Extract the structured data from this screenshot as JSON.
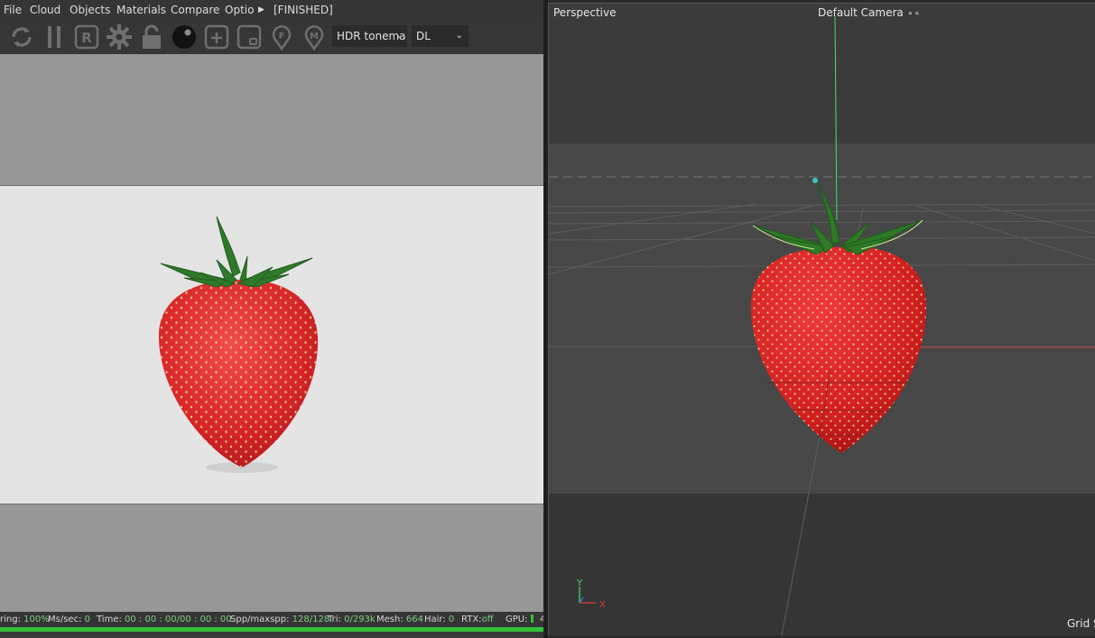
{
  "menu": {
    "items": [
      "File",
      "Cloud",
      "Objects",
      "Materials",
      "Compare",
      "Optior"
    ],
    "status_tag": "[FINISHED]"
  },
  "toolbar": {
    "icons": [
      "restart-render-icon",
      "pause-icon",
      "region-render-icon",
      "settings-gear-icon",
      "lock-icon",
      "material-ball-icon",
      "add-object-icon",
      "frame-icon",
      "focus-picker-icon",
      "material-picker-icon"
    ],
    "tonemap_select": "HDR tonema",
    "kernel_select": "DL"
  },
  "statusbar": {
    "rendering_label": "ring:",
    "rendering_value": "100%",
    "mssec_label": "Ms/sec:",
    "mssec_value": "0",
    "time_label": "Time:",
    "time_value": "00 : 00 : 00/00 : 00 : 00",
    "spp_label": "Spp/maxspp:",
    "spp_value": "128/128",
    "tri_label": "Tri:",
    "tri_value": "0/293k",
    "mesh_label": "Mesh:",
    "mesh_value": "664",
    "hair_label": "Hair:",
    "hair_value": "0",
    "rtx_label": "RTX:",
    "rtx_value": "off",
    "gpu_label": "GPU:",
    "gpu_extra": "4"
  },
  "progress": {
    "fraction": 1.0,
    "color": "#31c13a"
  },
  "viewport": {
    "projection": "Perspective",
    "camera": "Default Camera",
    "grid_label": "Grid S",
    "axis_y": "Y",
    "axis_x": "X"
  },
  "colors": {
    "strawberry_red": "#d8262a",
    "leaf_green": "#2f7a2a",
    "axis_green": "#3ee07a",
    "axis_red": "#e23a3a"
  }
}
